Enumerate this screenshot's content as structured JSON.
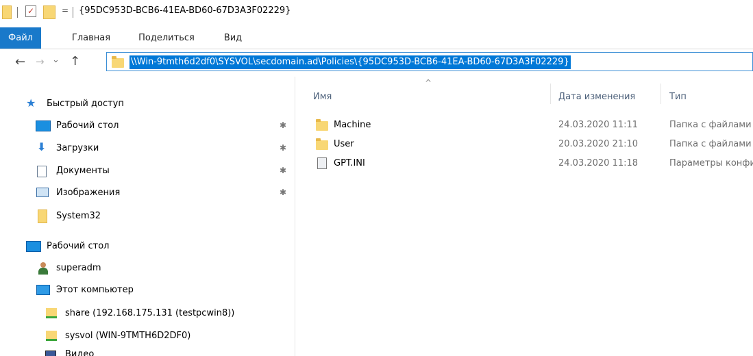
{
  "window": {
    "title": "{95DC953D-BCB6-41EA-BD60-67D3A3F02229}",
    "qat_dropdown": "="
  },
  "ribbon": {
    "tabs": [
      "Файл",
      "Главная",
      "Поделиться",
      "Вид"
    ]
  },
  "nav": {
    "back": "←",
    "forward": "→",
    "recent": "⌄",
    "up": "↑",
    "address": "\\\\Win-9tmth6d2df0\\SYSVOL\\secdomain.ad\\Policies\\{95DC953D-BCB6-41EA-BD60-67D3A3F02229}"
  },
  "sidebar": {
    "items": [
      {
        "label": "Быстрый доступ",
        "icon": "star-icon"
      },
      {
        "label": "Рабочий стол",
        "icon": "desktop-icon",
        "pinned": true
      },
      {
        "label": "Загрузки",
        "icon": "download-icon",
        "pinned": true
      },
      {
        "label": "Документы",
        "icon": "documents-icon",
        "pinned": true
      },
      {
        "label": "Изображения",
        "icon": "pictures-icon",
        "pinned": true
      },
      {
        "label": "System32",
        "icon": "folder-icon"
      },
      {
        "label": "Рабочий стол",
        "icon": "desktop-icon"
      },
      {
        "label": "superadm",
        "icon": "user-icon"
      },
      {
        "label": "Этот компьютер",
        "icon": "computer-icon"
      },
      {
        "label": "share (192.168.175.131 (testpcwin8))",
        "icon": "network-drive-icon"
      },
      {
        "label": "sysvol (WIN-9TMTH6D2DF0)",
        "icon": "network-drive-icon"
      },
      {
        "label": "Видео",
        "icon": "video-icon"
      }
    ]
  },
  "content": {
    "sort_indicator": "^",
    "columns": [
      "Имя",
      "Дата изменения",
      "Тип"
    ],
    "rows": [
      {
        "name": "Machine",
        "date": "24.03.2020 11:11",
        "type": "Папка с файлами",
        "icon": "folder-icon"
      },
      {
        "name": "User",
        "date": "20.03.2020 21:10",
        "type": "Папка с файлами",
        "icon": "folder-icon"
      },
      {
        "name": "GPT.INI",
        "date": "24.03.2020 11:18",
        "type": "Параметры конфигурации",
        "icon": "ini-file-icon"
      }
    ]
  }
}
